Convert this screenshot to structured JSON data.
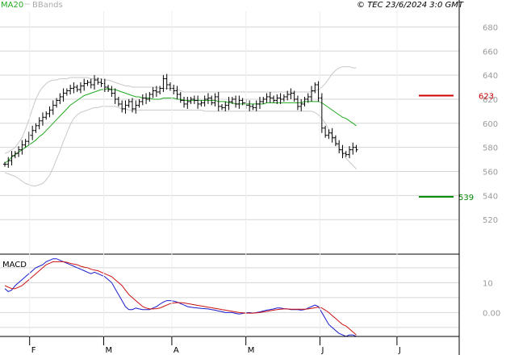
{
  "header": {
    "legend_ma": "MA20",
    "legend_bb": "BBands",
    "copyright": "© TEC 23/6/2024 3:0 GMT"
  },
  "colors": {
    "price": "#000000",
    "ma": "#22aa22",
    "bbands": "#c8c8c8",
    "resistance": "#cc0000",
    "support": "#008800",
    "macd": "#1a1acc",
    "signal": "#cc1111",
    "grid": "#d6d6d6",
    "axis": "#000000"
  },
  "chart_data": [
    {
      "type": "ohlc",
      "name": "price",
      "ylim": [
        492,
        693
      ],
      "yticks": [
        520,
        540,
        560,
        580,
        600,
        620,
        640,
        660,
        680
      ],
      "xticks": [
        "F",
        "M",
        "A",
        "M",
        "J",
        "J"
      ],
      "x_range": [
        -10,
        145
      ],
      "xtick_positions": [
        0,
        25,
        48,
        73,
        98,
        124
      ],
      "grid": true,
      "levels": {
        "resistance": {
          "value": 623,
          "label": "623"
        },
        "support": {
          "value": 539,
          "label": "539"
        }
      },
      "series": {
        "close": [
          566,
          569,
          573,
          575,
          578,
          582,
          585,
          590,
          594,
          598,
          602,
          605,
          608,
          611,
          615,
          619,
          622,
          625,
          627,
          629,
          630,
          628,
          631,
          633,
          634,
          632,
          636,
          634,
          633,
          630,
          628,
          625,
          620,
          616,
          612,
          615,
          618,
          612,
          615,
          618,
          621,
          620,
          624,
          627,
          626,
          629,
          637,
          632,
          629,
          627,
          624,
          619,
          616,
          618,
          620,
          619,
          616,
          617,
          620,
          621,
          617,
          622,
          614,
          613,
          615,
          618,
          620,
          616,
          619,
          617,
          615,
          614,
          613,
          616,
          618,
          620,
          622,
          621,
          619,
          621,
          620,
          622,
          624,
          625,
          620,
          614,
          616,
          620,
          622,
          627,
          632,
          621,
          596,
          590,
          592,
          588,
          583,
          578,
          575,
          574,
          578,
          580,
          578
        ],
        "ma20": [
          567,
          569,
          572,
          574,
          576,
          578,
          580,
          582,
          584,
          586,
          589,
          591,
          594,
          597,
          600,
          603,
          606,
          609,
          612,
          615,
          617,
          619,
          621,
          623,
          624,
          625,
          626,
          627,
          628,
          628,
          629,
          628,
          628,
          627,
          626,
          625,
          624,
          623,
          622,
          622,
          621,
          621,
          621,
          620,
          620,
          620,
          621,
          621,
          621,
          621,
          620,
          620,
          619,
          619,
          619,
          619,
          619,
          619,
          619,
          619,
          619,
          619,
          618,
          618,
          618,
          617,
          617,
          616,
          616,
          616,
          616,
          616,
          616,
          616,
          616,
          616,
          617,
          617,
          617,
          617,
          617,
          617,
          617,
          617,
          617,
          617,
          617,
          618,
          618,
          618,
          618,
          618,
          617,
          615,
          613,
          611,
          609,
          607,
          605,
          604,
          602,
          600,
          598
        ],
        "bb_upper": [
          575,
          576,
          578,
          580,
          584,
          588,
          595,
          603,
          612,
          620,
          626,
          630,
          633,
          635,
          636,
          636,
          637,
          637,
          637,
          638,
          638,
          638,
          638,
          638,
          638,
          637,
          637,
          637,
          637,
          636,
          636,
          635,
          634,
          633,
          632,
          631,
          631,
          630,
          630,
          630,
          630,
          630,
          630,
          630,
          630,
          629,
          629,
          629,
          629,
          629,
          628,
          627,
          626,
          626,
          626,
          626,
          626,
          626,
          626,
          626,
          626,
          626,
          626,
          626,
          626,
          626,
          626,
          626,
          626,
          626,
          626,
          626,
          626,
          626,
          626,
          626,
          626,
          626,
          626,
          626,
          626,
          626,
          626,
          626,
          626,
          626,
          626,
          626,
          626,
          626,
          627,
          628,
          630,
          633,
          637,
          641,
          644,
          646,
          647,
          647,
          647,
          646,
          646
        ],
        "bb_lower": [
          559,
          558,
          557,
          556,
          554,
          552,
          550,
          549,
          548,
          548,
          549,
          550,
          553,
          557,
          563,
          570,
          577,
          585,
          592,
          599,
          604,
          607,
          609,
          610,
          611,
          612,
          613,
          613,
          614,
          614,
          614,
          614,
          614,
          613,
          612,
          612,
          611,
          611,
          611,
          611,
          611,
          611,
          611,
          611,
          611,
          611,
          611,
          611,
          611,
          611,
          611,
          611,
          611,
          611,
          611,
          611,
          611,
          611,
          610,
          610,
          610,
          610,
          610,
          610,
          610,
          610,
          610,
          610,
          610,
          610,
          610,
          610,
          610,
          610,
          610,
          610,
          610,
          610,
          610,
          610,
          610,
          610,
          610,
          610,
          610,
          610,
          610,
          610,
          610,
          610,
          609,
          607,
          604,
          600,
          595,
          590,
          585,
          580,
          575,
          571,
          568,
          565,
          562
        ]
      }
    },
    {
      "type": "line",
      "name": "MACD",
      "title": "MACD",
      "ylim": [
        -8,
        19
      ],
      "yticks": [
        0,
        10
      ],
      "ytick_labels": [
        "0.00",
        "10"
      ],
      "series": [
        {
          "name": "macd",
          "values": [
            8,
            7,
            7.5,
            9,
            10,
            11,
            12,
            13,
            14,
            15,
            15.5,
            16,
            17,
            17.5,
            18,
            18,
            17.5,
            17,
            16.5,
            16,
            15.5,
            15,
            14.5,
            14,
            13.5,
            13,
            13.5,
            13,
            12.5,
            12,
            11,
            10,
            8,
            6,
            4,
            2,
            1,
            1,
            1.5,
            1.2,
            1,
            1,
            1,
            1.5,
            2,
            2.8,
            3.5,
            4,
            4,
            3.8,
            3.5,
            3,
            2.5,
            2,
            1.8,
            1.6,
            1.5,
            1.4,
            1.3,
            1.2,
            1,
            0.8,
            0.5,
            0.3,
            0,
            0,
            0,
            -0.3,
            -0.5,
            -0.3,
            -0.1,
            0,
            -0.2,
            0,
            0.2,
            0.5,
            0.8,
            1,
            1.2,
            1.5,
            1.5,
            1.3,
            1.2,
            1,
            1,
            1,
            0.8,
            1,
            1.5,
            2,
            2.5,
            2,
            0,
            -2,
            -4,
            -5,
            -6,
            -7,
            -7.5,
            -8,
            -7.5,
            -7.5,
            -8
          ]
        },
        {
          "name": "signal",
          "values": [
            9,
            8.5,
            8,
            8,
            8.5,
            9,
            10,
            11,
            12,
            13,
            14,
            15,
            16,
            16.5,
            17,
            17,
            17,
            17,
            16.8,
            16.5,
            16.2,
            16,
            15.5,
            15.2,
            15,
            14.5,
            14.2,
            14,
            13.5,
            13,
            12.5,
            12,
            11,
            10,
            9,
            7.5,
            6,
            5,
            4,
            3,
            2,
            1.5,
            1.2,
            1.2,
            1.3,
            1.5,
            2,
            2.5,
            3,
            3.2,
            3.3,
            3.3,
            3.2,
            3,
            2.8,
            2.6,
            2.4,
            2.2,
            2,
            1.8,
            1.6,
            1.4,
            1.2,
            1,
            0.8,
            0.6,
            0.4,
            0.2,
            0,
            -0.1,
            -0.2,
            -0.2,
            -0.2,
            -0.1,
            0,
            0.2,
            0.4,
            0.6,
            0.8,
            1,
            1.1,
            1.2,
            1.2,
            1.1,
            1.1,
            1.1,
            1.1,
            1.1,
            1.2,
            1.4,
            1.6,
            1.8,
            1.5,
            0.8,
            0,
            -1,
            -2,
            -3,
            -4,
            -4.5,
            -5.5,
            -6.5,
            -7.5
          ]
        }
      ]
    }
  ]
}
